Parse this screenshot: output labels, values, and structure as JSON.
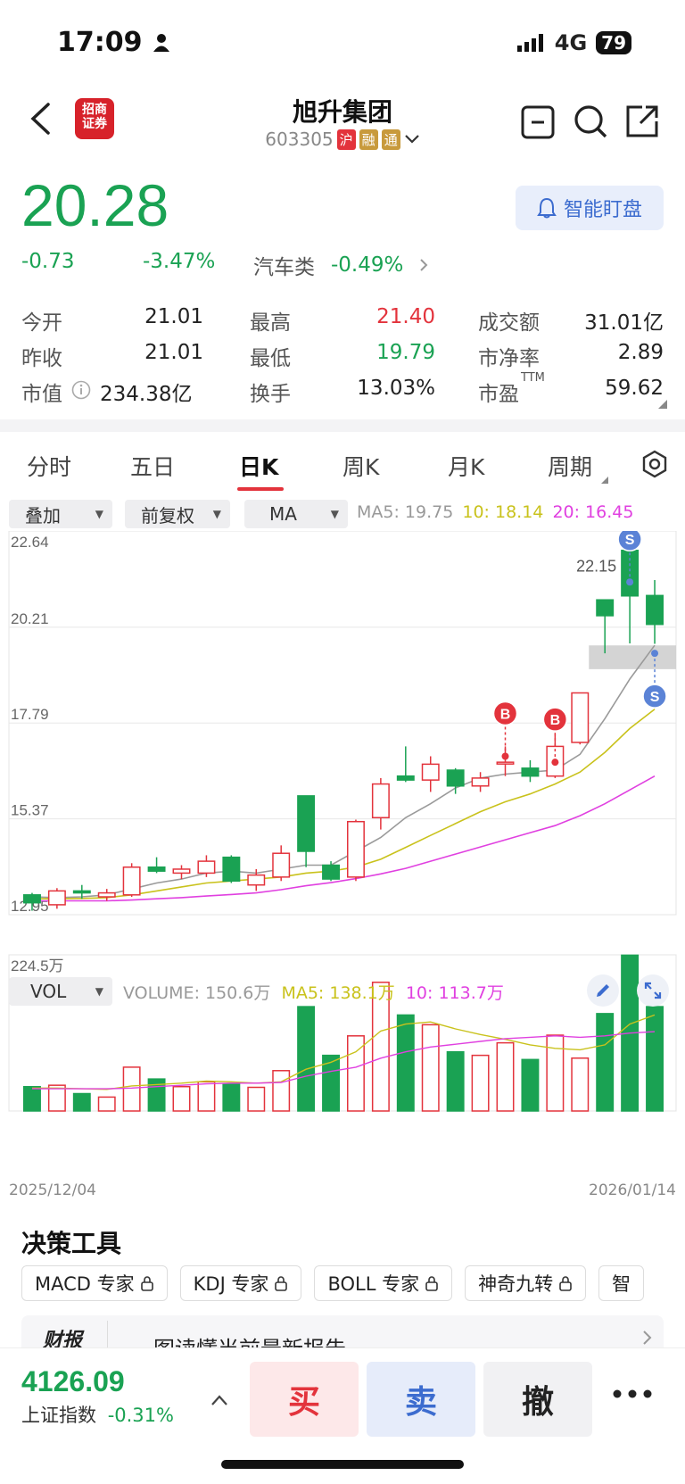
{
  "status": {
    "time": "17:09",
    "network": "4G",
    "battery": "79"
  },
  "header": {
    "broker_logo_top": "招商",
    "broker_logo_bottom": "证券",
    "stock_name": "旭升集团",
    "stock_code": "603305",
    "tags": [
      "沪",
      "融",
      "通"
    ]
  },
  "quote": {
    "price": "20.28",
    "change": "-0.73",
    "change_pct": "-3.47%",
    "sector": "汽车类",
    "sector_pct": "-0.49%",
    "smart_watch_label": "智能盯盘"
  },
  "stats": {
    "open_label": "今开",
    "open": "21.01",
    "high_label": "最高",
    "high": "21.40",
    "amount_label": "成交额",
    "amount": "31.01亿",
    "prev_label": "昨收",
    "prev": "21.01",
    "low_label": "最低",
    "low": "19.79",
    "pb_label": "市净率",
    "pb": "2.89",
    "mcap_label": "市值",
    "mcap": "234.38亿",
    "turnover_label": "换手",
    "turnover": "13.03%",
    "pe_label": "市盈",
    "pe_sup": "TTM",
    "pe": "59.62"
  },
  "tabs": [
    "分时",
    "五日",
    "日K",
    "周K",
    "月K",
    "周期"
  ],
  "active_tab": "日K",
  "controls": {
    "overlay": "叠加",
    "adjust": "前复权",
    "indicator": "MA",
    "vol": "VOL"
  },
  "ma_legend": {
    "ma5": "MA5: 19.75",
    "ma10": "10: 18.14",
    "ma20": "20: 16.45"
  },
  "vol_legend": {
    "volume": "VOLUME: 150.6万",
    "ma5": "MA5: 138.1万",
    "ma10": "10: 113.7万"
  },
  "colors": {
    "up": "#e3333c",
    "down": "#1aa253",
    "ma5": "#9a9a9a",
    "ma10": "#c9c21c",
    "ma20": "#e040e0",
    "accent": "#3c6ccf"
  },
  "chart_data": {
    "type": "candlestick",
    "y_ticks": [
      "22.64",
      "20.21",
      "17.79",
      "15.37",
      "12.95"
    ],
    "ylim": [
      12.95,
      22.64
    ],
    "peak_label": "22.15",
    "candles": [
      {
        "o": 13.45,
        "h": 13.5,
        "l": 13.05,
        "c": 13.25
      },
      {
        "o": 13.2,
        "h": 13.62,
        "l": 13.1,
        "c": 13.55
      },
      {
        "o": 13.55,
        "h": 13.7,
        "l": 13.35,
        "c": 13.5
      },
      {
        "o": 13.4,
        "h": 13.6,
        "l": 13.3,
        "c": 13.5
      },
      {
        "o": 13.45,
        "h": 14.25,
        "l": 13.4,
        "c": 14.15
      },
      {
        "o": 14.15,
        "h": 14.4,
        "l": 14.0,
        "c": 14.05
      },
      {
        "o": 14.0,
        "h": 14.2,
        "l": 13.85,
        "c": 14.1
      },
      {
        "o": 14.0,
        "h": 14.45,
        "l": 13.9,
        "c": 14.3
      },
      {
        "o": 14.4,
        "h": 14.45,
        "l": 13.75,
        "c": 13.8
      },
      {
        "o": 13.7,
        "h": 14.1,
        "l": 13.55,
        "c": 13.95
      },
      {
        "o": 13.9,
        "h": 14.7,
        "l": 13.8,
        "c": 14.5
      },
      {
        "o": 15.95,
        "h": 15.95,
        "l": 14.15,
        "c": 14.55
      },
      {
        "o": 14.2,
        "h": 14.3,
        "l": 13.8,
        "c": 13.85
      },
      {
        "o": 13.9,
        "h": 15.35,
        "l": 13.8,
        "c": 15.3
      },
      {
        "o": 15.4,
        "h": 16.4,
        "l": 15.1,
        "c": 16.25
      },
      {
        "o": 16.45,
        "h": 17.2,
        "l": 16.3,
        "c": 16.35
      },
      {
        "o": 16.35,
        "h": 16.95,
        "l": 16.05,
        "c": 16.75
      },
      {
        "o": 16.6,
        "h": 16.65,
        "l": 16.0,
        "c": 16.2
      },
      {
        "o": 16.2,
        "h": 16.55,
        "l": 16.05,
        "c": 16.4
      },
      {
        "o": 16.8,
        "h": 17.2,
        "l": 16.45,
        "c": 16.8
      },
      {
        "o": 16.65,
        "h": 16.85,
        "l": 16.3,
        "c": 16.45
      },
      {
        "o": 16.45,
        "h": 17.5,
        "l": 16.4,
        "c": 17.2
      },
      {
        "o": 17.3,
        "h": 18.55,
        "l": 17.25,
        "c": 18.55
      },
      {
        "o": 20.9,
        "h": 20.9,
        "l": 19.55,
        "c": 20.5
      },
      {
        "o": 22.15,
        "h": 22.35,
        "l": 19.8,
        "c": 21.0
      },
      {
        "o": 21.01,
        "h": 21.4,
        "l": 19.79,
        "c": 20.28
      }
    ],
    "ma5": [
      13.4,
      13.38,
      13.4,
      13.45,
      13.6,
      13.75,
      13.85,
      14.0,
      14.05,
      14.0,
      14.1,
      14.2,
      14.2,
      14.55,
      14.9,
      15.4,
      15.75,
      16.15,
      16.4,
      16.5,
      16.55,
      16.6,
      17.0,
      17.9,
      18.9,
      19.75
    ],
    "ma10": [
      13.35,
      13.35,
      13.36,
      13.38,
      13.45,
      13.55,
      13.65,
      13.75,
      13.8,
      13.85,
      13.9,
      14.0,
      14.05,
      14.15,
      14.35,
      14.65,
      14.95,
      15.25,
      15.55,
      15.8,
      16.0,
      16.25,
      16.55,
      17.05,
      17.65,
      18.14
    ],
    "ma20": [
      13.3,
      13.3,
      13.3,
      13.3,
      13.32,
      13.35,
      13.38,
      13.42,
      13.46,
      13.5,
      13.58,
      13.68,
      13.76,
      13.86,
      13.98,
      14.12,
      14.3,
      14.48,
      14.66,
      14.84,
      15.02,
      15.2,
      15.45,
      15.75,
      16.1,
      16.45
    ],
    "markers": [
      {
        "index": 19,
        "type": "B",
        "price": 16.95
      },
      {
        "index": 21,
        "type": "B",
        "price": 16.8
      },
      {
        "index": 24,
        "type": "S",
        "price": 21.35
      },
      {
        "index": 25,
        "type": "S",
        "price": 19.55
      }
    ],
    "support_zone": [
      19.15,
      19.75
    ],
    "vol_max_label": "224.5万",
    "volume": [
      35,
      37,
      25,
      20,
      63,
      46,
      35,
      42,
      39,
      34,
      58,
      150,
      80,
      108,
      185,
      138,
      124,
      85,
      80,
      98,
      74,
      109,
      76,
      140,
      224,
      150
    ],
    "vol_ma5": [
      33,
      33,
      32,
      31,
      36,
      38,
      40,
      43,
      42,
      40,
      42,
      60,
      70,
      85,
      115,
      125,
      128,
      118,
      110,
      103,
      95,
      90,
      88,
      95,
      125,
      138
    ],
    "vol_ma10": [
      32,
      32,
      32,
      32,
      33,
      35,
      37,
      39,
      40,
      40,
      41,
      50,
      57,
      63,
      76,
      85,
      92,
      96,
      100,
      104,
      106,
      108,
      106,
      108,
      112,
      114
    ],
    "vol_ylim": [
      0,
      224.5
    ],
    "date_start": "2025/12/04",
    "date_end": "2026/01/14"
  },
  "tools": {
    "section_title": "决策工具",
    "items": [
      "MACD 专家",
      "KDJ 专家",
      "BOLL 专家",
      "神奇九转",
      "智"
    ],
    "report_icon": "财报",
    "report_text": "一图读懂当前最新报告"
  },
  "bottom": {
    "index_value": "4126.09",
    "index_name": "上证指数",
    "index_pct": "-0.31%",
    "buy": "买",
    "sell": "卖",
    "cancel": "撤"
  }
}
